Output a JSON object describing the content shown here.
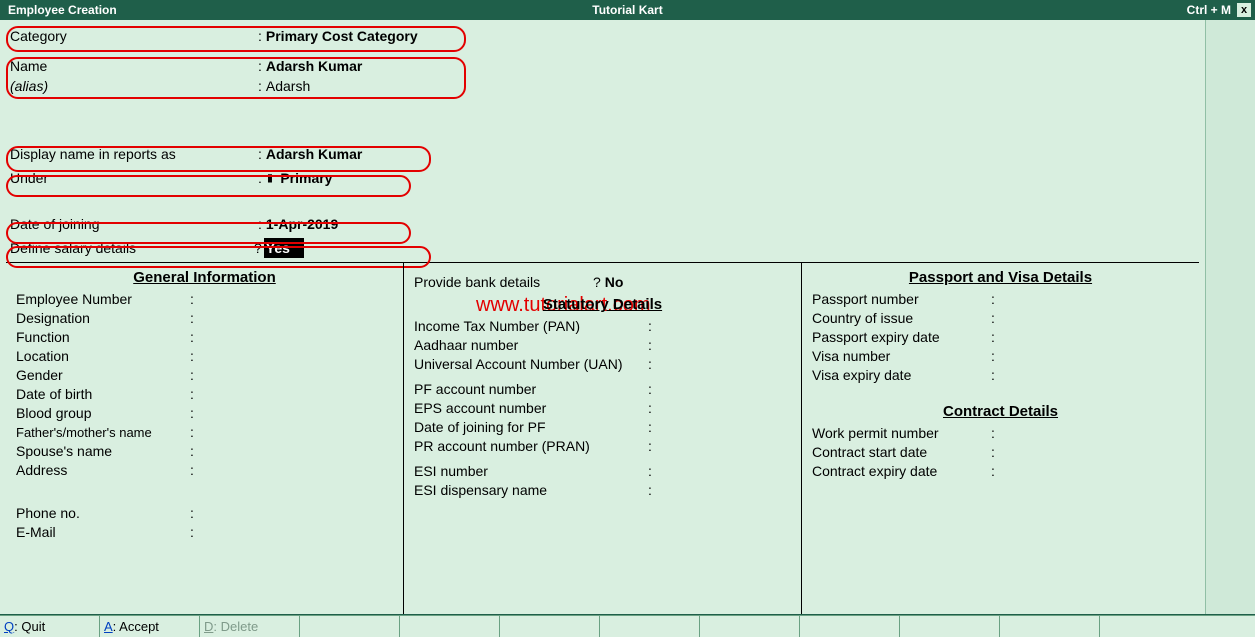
{
  "titlebar": {
    "left": "Employee  Creation",
    "center": "Tutorial Kart",
    "shortcut": "Ctrl + M",
    "close": "x"
  },
  "fields": {
    "category_label": "Category",
    "category_value": "Primary Cost Category",
    "name_label": "Name",
    "name_value": "Adarsh Kumar",
    "alias_label": "(alias)",
    "alias_value": "Adarsh",
    "display_label": "Display name in reports as",
    "display_value": "Adarsh Kumar",
    "under_label": "Under",
    "under_value": "Primary",
    "doj_label": "Date of joining",
    "doj_value": "1-Apr-2019",
    "salary_label": "Define salary details",
    "salary_value": "Yes"
  },
  "watermark": "www.tutorialart.com",
  "general": {
    "heading": "General Information",
    "emp_no": "Employee Number",
    "designation": "Designation",
    "func": "Function",
    "location": "Location",
    "gender": "Gender",
    "dob": "Date of birth",
    "blood": "Blood group",
    "parents": "Father's/mother's name",
    "spouse": "Spouse's name",
    "address": "Address",
    "phone": "Phone no.",
    "email": "E-Mail"
  },
  "stat": {
    "bank_label": "Provide bank details",
    "bank_value": "No",
    "heading": "Statutory Details",
    "pan": "Income Tax Number (PAN)",
    "aadhaar": "Aadhaar number",
    "uan": "Universal Account Number (UAN)",
    "pf": "PF account number",
    "eps": "EPS account number",
    "dojpf": "Date of joining for PF",
    "pran": "PR account number (PRAN)",
    "esi": "ESI number",
    "esidisp": "ESI dispensary name"
  },
  "passport": {
    "heading": "Passport and Visa Details",
    "ppno": "Passport number",
    "country": "Country of issue",
    "ppexp": "Passport expiry date",
    "visano": "Visa number",
    "visaexp": "Visa expiry date"
  },
  "contract": {
    "heading": "Contract Details",
    "wpermit": "Work permit number",
    "cstart": "Contract start date",
    "cexpiry": "Contract expiry date"
  },
  "bottom": {
    "quit_hot": "Q",
    "quit_rest": ": Quit",
    "accept_hot": "A",
    "accept_rest": ": Accept",
    "delete_hot": "D",
    "delete_rest": ": Delete"
  }
}
